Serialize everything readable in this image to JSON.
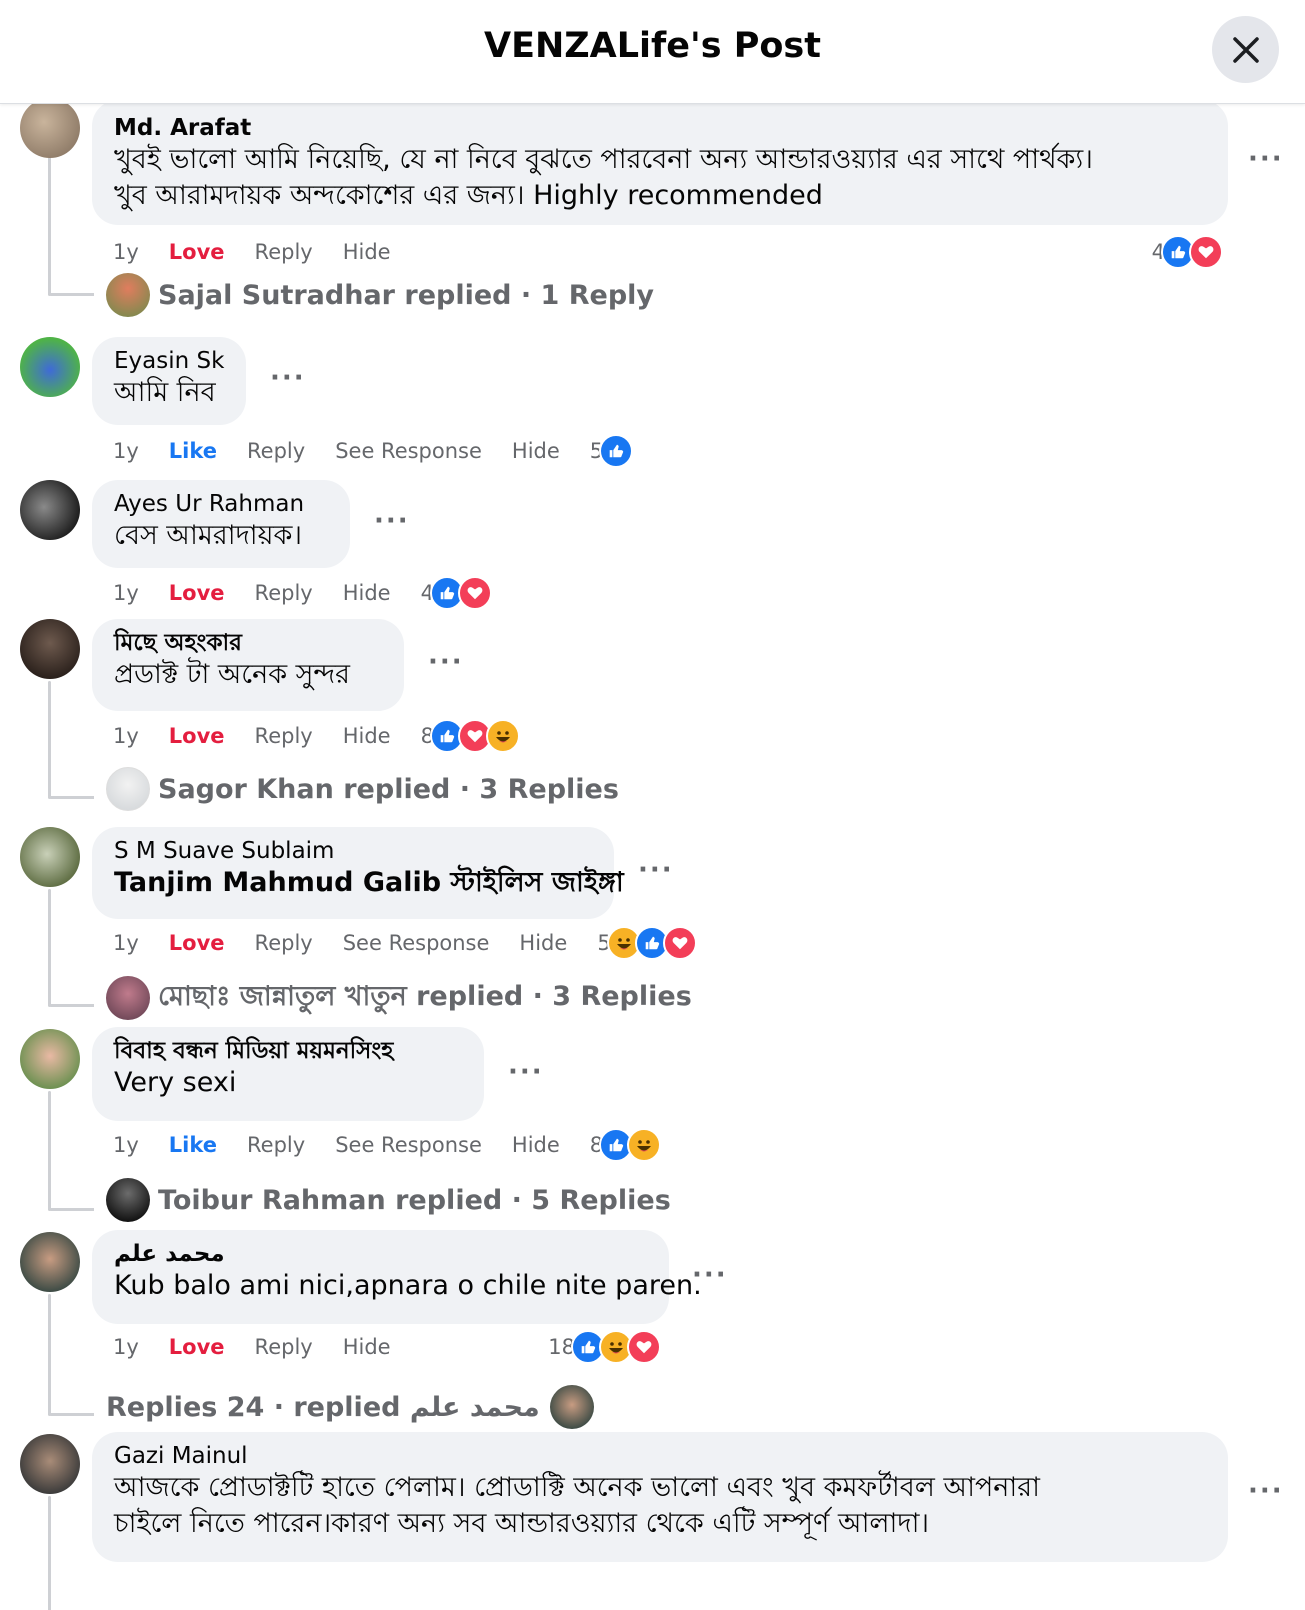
{
  "header": {
    "title": "VENZALife's Post",
    "close_icon": "close-icon"
  },
  "comments": [
    {
      "name": "Md. Arafat",
      "text_lines": [
        "খুবই ভালো আমি নিয়েছি, যে না নিবে বুঝতে পারবেনা অন্য আন্ডারওয়্যার এর সাথে পার্থক্য।",
        "খুব আরামদায়ক অন্দকোশের এর জন্য। Highly recommended"
      ],
      "time": "1y",
      "reaction_label": "Love",
      "reply": "Reply",
      "hide": "Hide",
      "reaction_count": "4",
      "reactions": [
        "like",
        "love"
      ],
      "replied": {
        "text": "Sajal Sutradhar replied · 1 Reply"
      }
    },
    {
      "name": "Eyasin Sk",
      "text_lines": [
        "আমি নিব"
      ],
      "time": "1y",
      "reaction_label": "Like",
      "reply": "Reply",
      "see_response": "See Response",
      "hide": "Hide",
      "reaction_count": "5",
      "reactions": [
        "like"
      ]
    },
    {
      "name": "Ayes Ur Rahman",
      "text_lines": [
        "বেস আমরাদায়ক।"
      ],
      "time": "1y",
      "reaction_label": "Love",
      "reply": "Reply",
      "hide": "Hide",
      "reaction_count": "4",
      "reactions": [
        "like",
        "love"
      ]
    },
    {
      "name": "মিছে অহংকার",
      "text_lines": [
        "প্রডাক্ট টা অনেক সুন্দর"
      ],
      "time": "1y",
      "reaction_label": "Love",
      "reply": "Reply",
      "hide": "Hide",
      "reaction_count": "8",
      "reactions": [
        "like",
        "love",
        "haha"
      ],
      "replied": {
        "text": "Sagor Khan replied · 3 Replies"
      }
    },
    {
      "name": "S M Suave Sublaim",
      "text_lines": [
        "Tanjim Mahmud Galib স্টাইলিস জাইঙ্গা"
      ],
      "time": "1y",
      "reaction_label": "Love",
      "reply": "Reply",
      "see_response": "See Response",
      "hide": "Hide",
      "reaction_count": "5",
      "reactions": [
        "haha",
        "like",
        "love"
      ],
      "replied": {
        "text": "মোছাঃ জান্নাতুল খাতুন replied · 3 Replies"
      }
    },
    {
      "name": "বিবাহ বন্ধন মিডিয়া ময়মনসিংহ",
      "text_lines": [
        "Very sexi"
      ],
      "time": "1y",
      "reaction_label": "Like",
      "reply": "Reply",
      "see_response": "See Response",
      "hide": "Hide",
      "reaction_count": "8",
      "reactions": [
        "like",
        "haha"
      ],
      "replied": {
        "text": "Toibur Rahman replied · 5 Replies"
      }
    },
    {
      "name": "محمد علم",
      "text_lines": [
        "Kub balo ami nici,apnara o chile nite paren."
      ],
      "time": "1y",
      "reaction_label": "Love",
      "reply": "Reply",
      "hide": "Hide",
      "reaction_count": "18",
      "reactions": [
        "like",
        "haha",
        "love"
      ],
      "replied": {
        "text": "Replies 24 · replied محمد علم"
      }
    },
    {
      "name": "Gazi Mainul",
      "text_lines": [
        "আজকে প্রোডাক্টটি হাতে পেলাম। প্রোডাক্টি অনেক ভালো এবং খুব কমফর্টাবল আপনারা",
        "চাইলে নিতে পারেন।কারণ অন্য সব আন্ডারওয়্যার থেকে এটি সম্পূর্ণ আলাদা।"
      ]
    }
  ],
  "more_icon": "more-options-icon"
}
